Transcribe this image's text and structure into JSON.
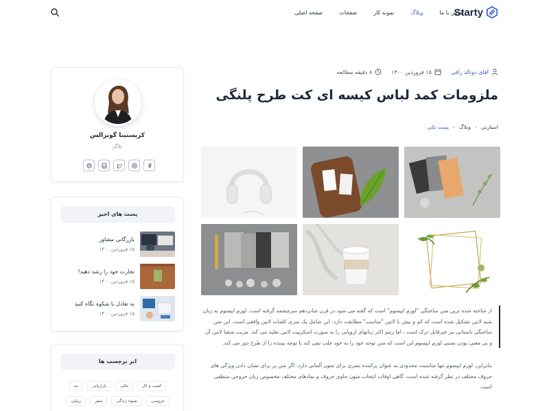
{
  "header": {
    "logo_text": "Starty",
    "nav": [
      {
        "label": "صفحه اصلی",
        "active": false
      },
      {
        "label": "صفحات",
        "active": false
      },
      {
        "label": "نمونه کار",
        "active": false
      },
      {
        "label": "وبلاگ",
        "active": true
      },
      {
        "label": "تماس با ما",
        "active": false
      }
    ]
  },
  "article": {
    "author": "آقای دونالد راقی",
    "date": "۱۵ فروردین ۱۴۰۰",
    "read_time": "۸ دقیقه مطالعه",
    "title": "ملزومات کمد لباس کیسه ای کت طرح پلنگی",
    "breadcrumb": [
      "استارتی",
      "وبلاگ",
      "پست تکی"
    ],
    "gallery": [
      "headphones",
      "business-cards-on-wood",
      "color-envelopes",
      "stationery-flatlay",
      "paper-cup",
      "gold-frame-leaves"
    ],
    "paragraph1": "از شاخته شده ترین متن ساختگی \"لورم ایپسوم\" است که گفته می شود در قرن شانزدهم سرچشمه گرفته است. لورم ایپسوم به زبان شبه لاتین تشکیل شده است که کم و بیش با لاتین \"مناسب\" مطابقت دارد. این شامل یک سری کلمات لاتین واقعی است. این متن ساختگی باستانی نیز غیرقابل درک است ، اما ریتم اکثر زبانهای اروپایی را به صورت اسکریپت لاتین تقلید می کند. مزیت منشا لاتین آن و بی معنی بودن نسبی لورم ایپسوم این است که متن توجه خود را به خود جلب نمی کند یا توجه بیننده را از طرح دور می کند.",
    "paragraph2": "بنابراین، لورم ایپسوم تنها مناسبت محدودی به عنوان پرکننده بصری برای متون آلمانی دارد. اگر متن پر برای نشان دادن ویژگی های حروف مختلف در نظر گرفته شده است، گاهی اوقات انتخاب متون حاوی حروف و نمادهای مختلف مخصوص زبان خروجی منطقی است."
  },
  "sidebar": {
    "profile": {
      "name": "کریستینا گونزالس",
      "role": "بلاگر",
      "socials": [
        "facebook-icon",
        "instagram-icon",
        "twitter-icon",
        "linkedin-icon",
        "dribbble-icon"
      ]
    },
    "recent": {
      "title": "پست های اخیر",
      "posts": [
        {
          "title": "بازرگانی مشاور",
          "date": "۱۵ فروردین ۱۴۰۰"
        },
        {
          "title": "تجارت خود را رشد دهید!",
          "date": "۱۵ فروردین ۱۴۰۰"
        },
        {
          "title": "به تعادل با شکوه نگاه کنید",
          "date": "۱۵ فروردین ۱۴۰۰"
        }
      ]
    },
    "tags": {
      "title": "ابر برچسب ها",
      "items": [
        "کسب و کار",
        "مالی",
        "بازاریابی",
        "مد",
        "عروسی",
        "شیوه زندگی",
        "سفر",
        "زیبایی"
      ]
    }
  },
  "colors": {
    "accent": "#2f55d4",
    "text": "#1e2a3b",
    "muted": "#8a93a3"
  }
}
